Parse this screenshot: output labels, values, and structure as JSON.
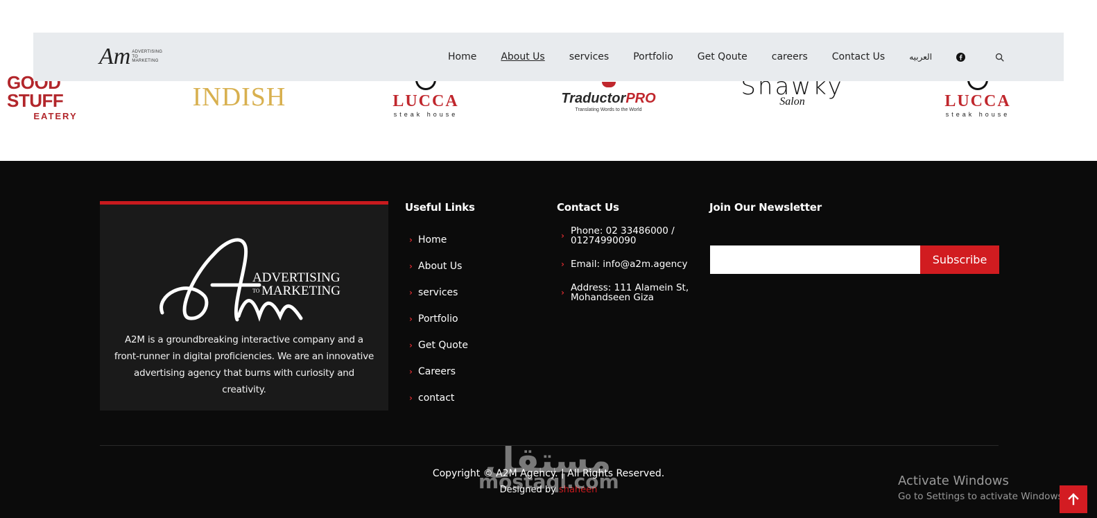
{
  "clients": {
    "goodstuff": {
      "line1": "GOOD STUFF",
      "line2": "EATERY"
    },
    "indish": {
      "name": "INDISH"
    },
    "lucca": {
      "line1": "LUCCA",
      "line2": "steak house"
    },
    "traductor": {
      "name_a": "Traductor",
      "name_b": "PRO",
      "tagline": "Translating Words to the World"
    },
    "shawky": {
      "line1": "Shawky",
      "line2": "Salon"
    }
  },
  "header": {
    "brand": {
      "mark": "Am",
      "sub1": "ADVERTISING",
      "sub2": "TO MARKETING"
    },
    "nav": {
      "home": "Home",
      "about": "About Us",
      "services": "services",
      "portfolio": "Portfolio",
      "quote": "Get Qoute",
      "careers": "careers",
      "contact": "Contact Us",
      "arabic": "العربيه"
    },
    "icons": {
      "facebook": "facebook-icon",
      "search": "search-icon"
    }
  },
  "footer": {
    "about": {
      "logo_line1": "ADVERTISING",
      "logo_line2_small": "TO",
      "logo_line2": "MARKETING",
      "text": "A2M is a groundbreaking interactive company and a front-runner in digital proficiencies. We are an innovative advertising agency that burns with curiosity and creativity."
    },
    "useful_links": {
      "title": "Useful Links",
      "items": [
        {
          "label": "Home"
        },
        {
          "label": "About Us"
        },
        {
          "label": "services"
        },
        {
          "label": "Portfolio"
        },
        {
          "label": "Get Quote"
        },
        {
          "label": "Careers"
        },
        {
          "label": "contact"
        }
      ]
    },
    "contact": {
      "title": "Contact Us",
      "phone": "Phone: 02 33486000 / 01274990090",
      "email": "Email: info@a2m.agency",
      "address": "Address: 111 Alamein St, Mohandseen Giza"
    },
    "newsletter": {
      "title": "Join Our Newsletter",
      "placeholder": "",
      "button": "Subscribe"
    },
    "copyright": "Copyright © A2M Agency. | All Rights Reserved.",
    "designed_prefix": "Designed by ",
    "designed_author": "shaheen"
  },
  "overlay": {
    "watermark_ar": "مستقل",
    "watermark_lat": "mostaql.com",
    "activate_title": "Activate Windows",
    "activate_sub": "Go to Settings to activate Windows."
  },
  "colors": {
    "accent": "#c81a1e",
    "footer_bg": "#0b0b0b",
    "card_bg": "#1a1a1a",
    "header_bg": "#e8ebee"
  }
}
